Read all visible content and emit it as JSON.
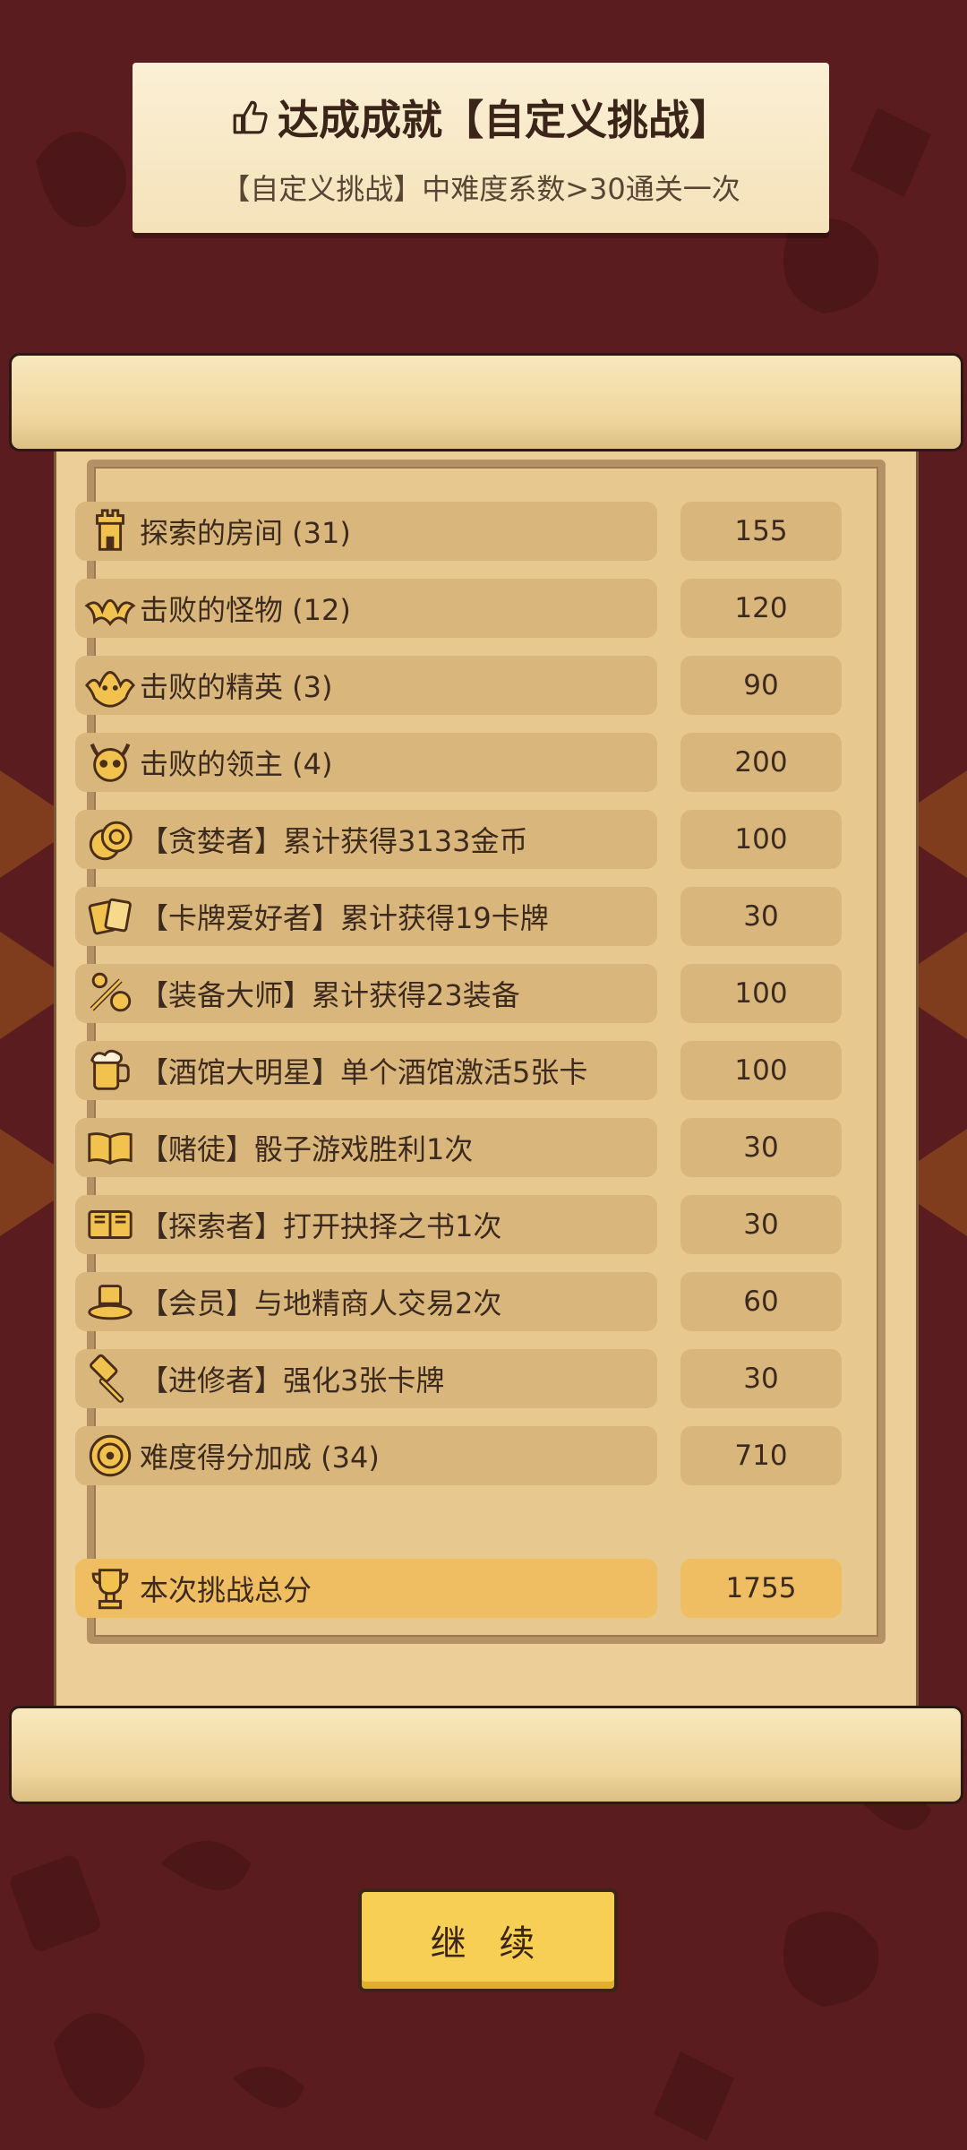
{
  "achievement": {
    "title": "达成成就【自定义挑战】",
    "description": "【自定义挑战】中难度系数>30通关一次"
  },
  "score_rows": [
    {
      "icon": "tower-icon",
      "label": "探索的房间 (31)",
      "value": "155"
    },
    {
      "icon": "bat-icon",
      "label": "击败的怪物 (12)",
      "value": "120"
    },
    {
      "icon": "elite-demon-icon",
      "label": "击败的精英 (3)",
      "value": "90"
    },
    {
      "icon": "boss-skull-icon",
      "label": "击败的领主 (4)",
      "value": "200"
    },
    {
      "icon": "coins-icon",
      "label": "【贪婪者】累计获得3133金币",
      "value": "100"
    },
    {
      "icon": "cards-icon",
      "label": "【卡牌爱好者】累计获得19卡牌",
      "value": "30"
    },
    {
      "icon": "equipment-icon",
      "label": "【装备大师】累计获得23装备",
      "value": "100"
    },
    {
      "icon": "beer-mug-icon",
      "label": "【酒馆大明星】单个酒馆激活5张卡",
      "value": "100"
    },
    {
      "icon": "dice-book-icon",
      "label": "【赌徒】骰子游戏胜利1次",
      "value": "30"
    },
    {
      "icon": "book-icon",
      "label": "【探索者】打开抉择之书1次",
      "value": "30"
    },
    {
      "icon": "top-hat-icon",
      "label": "【会员】与地精商人交易2次",
      "value": "60"
    },
    {
      "icon": "hammer-icon",
      "label": "【进修者】强化3张卡牌",
      "value": "30"
    },
    {
      "icon": "difficulty-badge-icon",
      "label": "难度得分加成 (34)",
      "value": "710"
    }
  ],
  "total": {
    "icon": "trophy-icon",
    "label": "本次挑战总分",
    "value": "1755"
  },
  "continue_label": "继 续",
  "colors": {
    "background": "#5a1c1f",
    "pill": "#d9b77c",
    "total_pill": "#efbd62",
    "button": "#f7cf55"
  }
}
